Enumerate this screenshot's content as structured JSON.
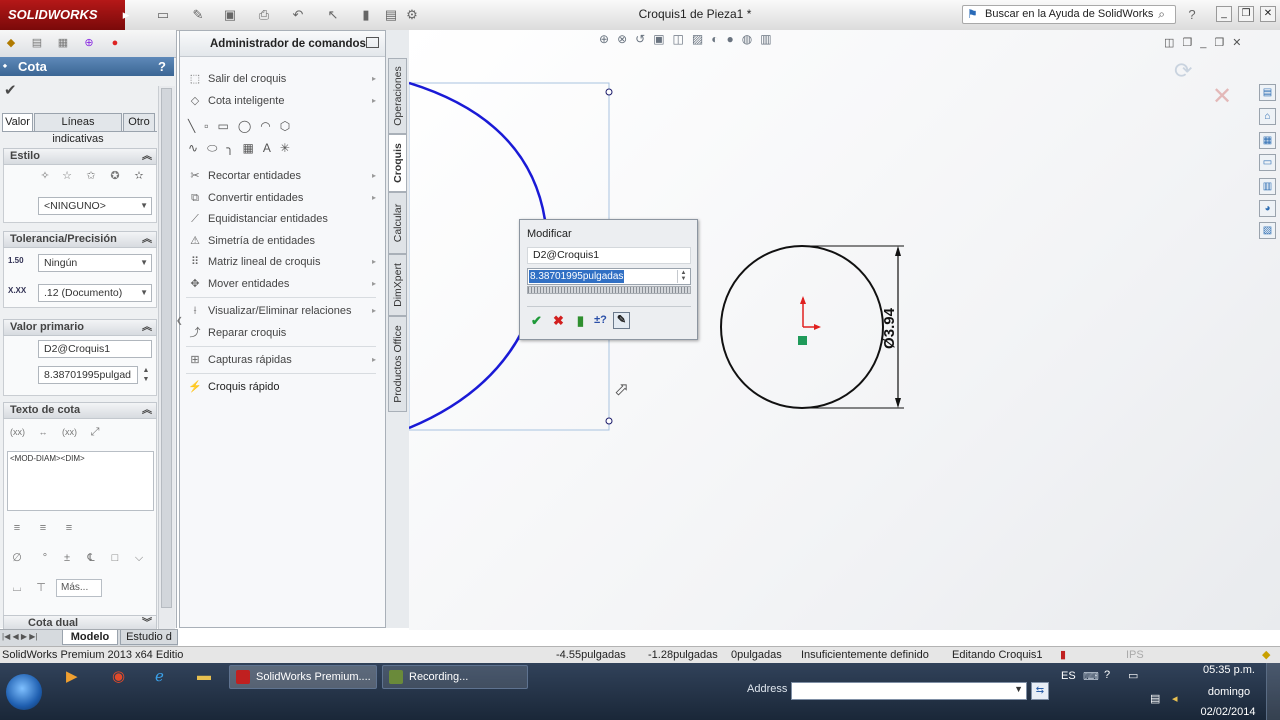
{
  "app": {
    "logo": "SOLIDWORKS",
    "document_title": "Croquis1 de Pieza1 *",
    "help_search_placeholder": "Buscar en la Ayuda de SolidWorks"
  },
  "property_manager": {
    "title": "Cota",
    "help_glyph": "?",
    "tabs": [
      "Valor",
      "Líneas indicativas",
      "Otro"
    ],
    "estilo": {
      "header": "Estilo",
      "combo": "<NINGUNO>"
    },
    "tolerancia": {
      "header": "Tolerancia/Precisión",
      "tolerance_combo": "Ningún",
      "precision_combo": ".12 (Documento)"
    },
    "valor_primario": {
      "header": "Valor primario",
      "name": "D2@Croquis1",
      "value": "8.38701995pulgad"
    },
    "texto_cota": {
      "header": "Texto de cota",
      "text": "<MOD-DIAM><DIM>",
      "more_button": "Más...",
      "next_header": "Cota dual"
    },
    "bottom_tabs": [
      "Modelo",
      "Estudio d"
    ]
  },
  "command_manager": {
    "title": "Administrador de comandos",
    "items_top": [
      "Salir del croquis",
      "Cota inteligente"
    ],
    "items_mid": [
      "Recortar entidades",
      "Convertir entidades",
      "Equidistanciar entidades",
      "Simetría de entidades",
      "Matriz lineal de croquis",
      "Mover entidades"
    ],
    "items_rel": [
      "Visualizar/Eliminar relaciones",
      "Reparar croquis"
    ],
    "items_capt": [
      "Capturas rápidas"
    ],
    "items_last": [
      "Croquis rápido"
    ],
    "vertical_tabs": [
      "Operaciones",
      "Croquis",
      "Calcular",
      "DimXpert",
      "Productos Office"
    ]
  },
  "modify_dialog": {
    "title": "Modificar",
    "name": "D2@Croquis1",
    "value": "8.38701995pulgadas"
  },
  "drawing": {
    "dimension_label": "Ø3.94",
    "arc_color": "#1a1ad6"
  },
  "status_bar": {
    "app_name": "SolidWorks Premium 2013 x64 Editio",
    "x": "-4.55pulgadas",
    "y": "-1.28pulgadas",
    "z": "0pulgadas",
    "definition": "Insuficientemente definido",
    "mode": "Editando Croquis1",
    "units": "IPS"
  },
  "taskbar": {
    "apps": [
      "SolidWorks Premium....",
      "Recording..."
    ],
    "address_label": "Address",
    "language": "ES",
    "time": "05:35 p.m.",
    "day": "domingo",
    "date": "02/02/2014"
  }
}
